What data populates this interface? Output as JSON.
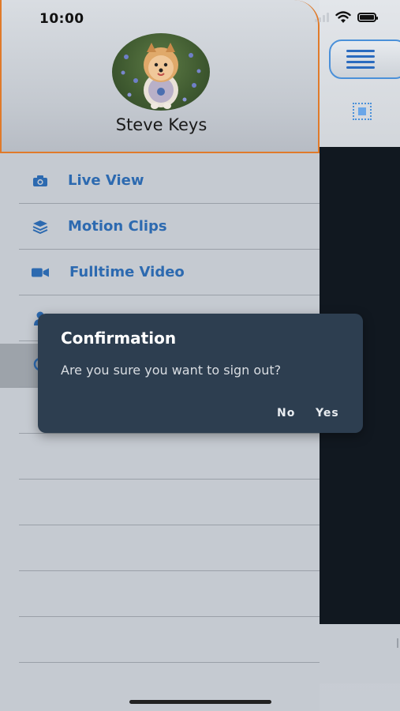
{
  "status_bar": {
    "time": "10:00"
  },
  "profile": {
    "name": "Steve Keys",
    "avatar_icon": "dog-photo"
  },
  "menu": {
    "items": [
      {
        "label": "Live View",
        "icon": "camera-icon"
      },
      {
        "label": "Motion Clips",
        "icon": "layers-icon"
      },
      {
        "label": "Fulltime Video",
        "icon": "video-camera-icon"
      },
      {
        "label": "",
        "icon": "user-icon"
      },
      {
        "label": "",
        "icon": "sign-out-icon"
      }
    ]
  },
  "dialog": {
    "title": "Confirmation",
    "message": "Are you sure you want to sign out?",
    "no_label": "No",
    "yes_label": "Yes"
  },
  "colors": {
    "accent_blue": "#2d6ab0",
    "header_border": "#e07a2a",
    "dialog_bg": "#2d3e50"
  }
}
